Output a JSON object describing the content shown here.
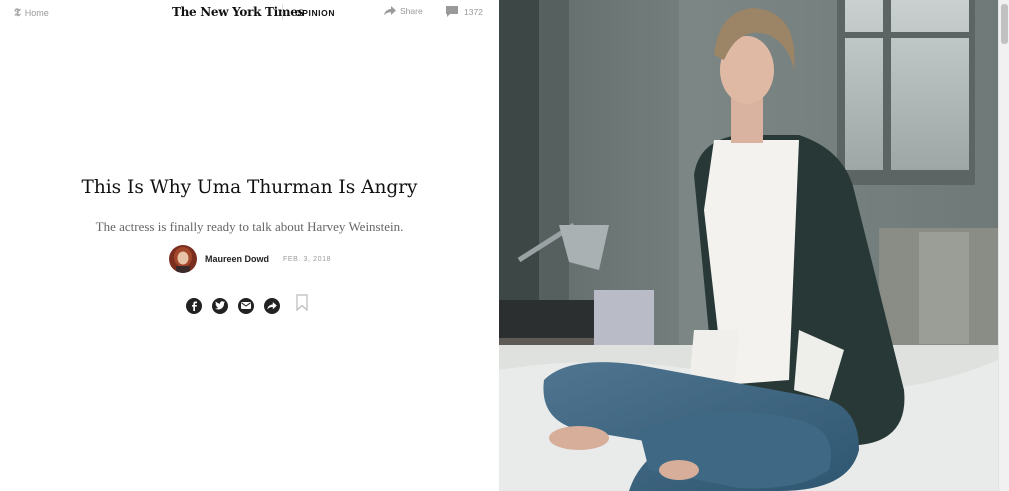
{
  "header": {
    "home_label": "Home",
    "logo_text": "The New York Times",
    "section_label": "OPINION",
    "share_label": "Share",
    "comment_count": "1372"
  },
  "article": {
    "headline": "This Is Why Uma Thurman Is Angry",
    "summary": "The actress is finally ready to talk about Harvey Weinstein.",
    "author": "Maureen Dowd",
    "date": "FEB. 3, 2018"
  },
  "icons": {
    "social": [
      "facebook-icon",
      "twitter-icon",
      "email-icon",
      "share-arrow-icon"
    ],
    "save": "bookmark-icon"
  },
  "colors": {
    "headline": "#111111",
    "muted": "#999999",
    "social_button": "#222222"
  }
}
